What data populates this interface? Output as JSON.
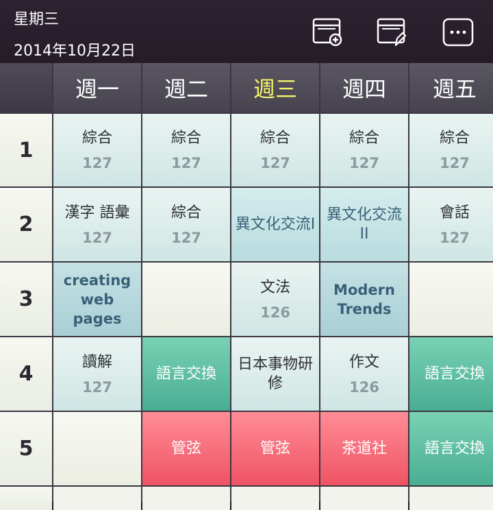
{
  "header": {
    "day": "星期三",
    "date": "2014年10月22日"
  },
  "days": [
    "週一",
    "週二",
    "週三",
    "週四",
    "週五"
  ],
  "today_index": 2,
  "periods": [
    "1",
    "2",
    "3",
    "4",
    "5"
  ],
  "rows": [
    [
      {
        "name": "綜合",
        "room": "127",
        "style": "light"
      },
      {
        "name": "綜合",
        "room": "127",
        "style": "light"
      },
      {
        "name": "綜合",
        "room": "127",
        "style": "light"
      },
      {
        "name": "綜合",
        "room": "127",
        "style": "light"
      },
      {
        "name": "綜合",
        "room": "127",
        "style": "light"
      }
    ],
    [
      {
        "name": "漢字 語彙",
        "room": "127",
        "style": "light"
      },
      {
        "name": "綜合",
        "room": "127",
        "style": "light"
      },
      {
        "name": "異文化交流I",
        "room": "",
        "style": "mid"
      },
      {
        "name": "異文化交流II",
        "room": "",
        "style": "mid"
      },
      {
        "name": "會話",
        "room": "127",
        "style": "light"
      }
    ],
    [
      {
        "name": "creating web pages",
        "room": "",
        "style": "dark"
      },
      {
        "name": "",
        "room": "",
        "style": "empty"
      },
      {
        "name": "文法",
        "room": "126",
        "style": "light"
      },
      {
        "name": "Modern Trends",
        "room": "",
        "style": "dark"
      },
      {
        "name": "",
        "room": "",
        "style": "empty"
      }
    ],
    [
      {
        "name": "讀解",
        "room": "127",
        "style": "light"
      },
      {
        "name": "語言交換",
        "room": "",
        "style": "green"
      },
      {
        "name": "日本事物研修",
        "room": "",
        "style": "light"
      },
      {
        "name": "作文",
        "room": "126",
        "style": "light"
      },
      {
        "name": "語言交換",
        "room": "",
        "style": "green"
      }
    ],
    [
      {
        "name": "",
        "room": "",
        "style": "empty"
      },
      {
        "name": "管弦",
        "room": "",
        "style": "red"
      },
      {
        "name": "管弦",
        "room": "",
        "style": "red"
      },
      {
        "name": "茶道社",
        "room": "",
        "style": "red"
      },
      {
        "name": "語言交換",
        "room": "",
        "style": "green"
      }
    ]
  ],
  "icons": {
    "add": "calendar-add-icon",
    "edit": "calendar-edit-icon",
    "more": "more-icon"
  },
  "colors": {
    "header_bg": "#2c2230",
    "today_text": "#f5f56a",
    "green": "#4aae93",
    "red": "#ef5364"
  }
}
